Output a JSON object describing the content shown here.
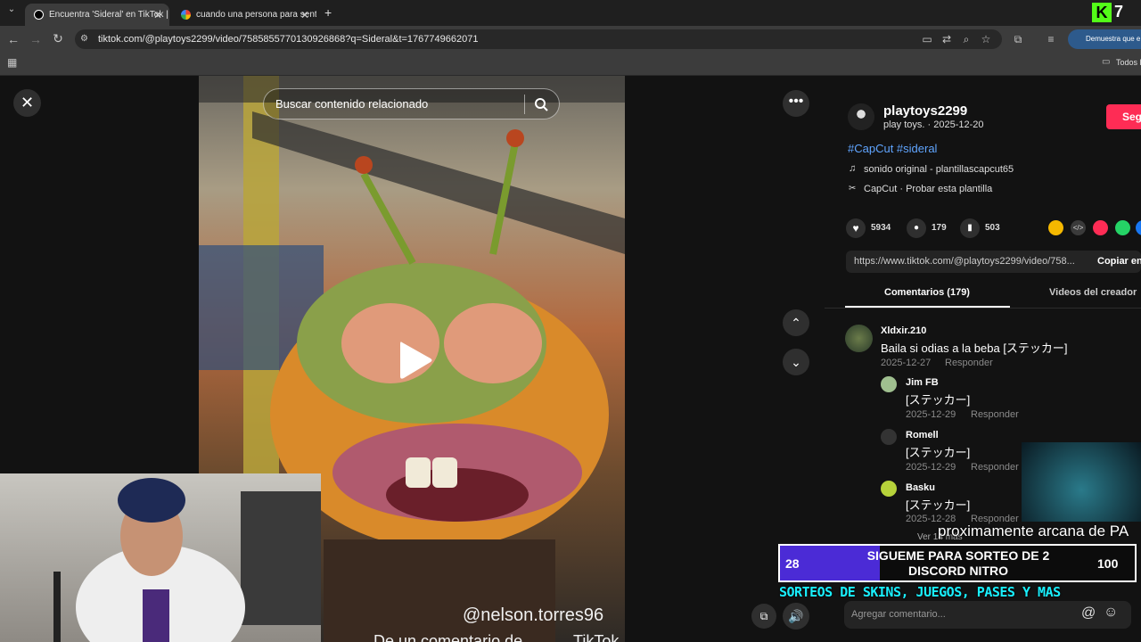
{
  "browser": {
    "tabs": [
      {
        "title": "Encuentra 'Sideral' en TikTok | B"
      },
      {
        "title": "cuando una persona para senta"
      }
    ],
    "new_tab": "+",
    "url": "tiktok.com/@playtoys2299/video/7585855770130926868?q=Sideral&t=1767749662071",
    "profile_text": "Demuestra que e",
    "bookmarks_all": "Todos l",
    "k_badge": "7"
  },
  "video": {
    "search_placeholder": "Buscar contenido relacionado",
    "watermark": "@nelson.torres96",
    "bottom_caption": "De un comentario de",
    "tiktok_mark": "TikTok"
  },
  "author": {
    "username": "playtoys2299",
    "subline": "play toys. · 2025-12-20",
    "follow": "Seg",
    "hashtags": "#CapCut #sideral",
    "sound": "sonido original - plantillascapcut65",
    "capcut": "CapCut · Probar esta plantilla"
  },
  "stats": {
    "likes": "5934",
    "comments": "179",
    "saves": "503"
  },
  "share": {
    "link": "https://www.tiktok.com/@playtoys2299/video/758...",
    "copy": "Copiar en"
  },
  "tabs": {
    "comments": "Comentarios (179)",
    "creator": "Videos del creador"
  },
  "comments": [
    {
      "name": "Xldxir.210",
      "text": "Baila si odias a la beba [ステッカー]",
      "date": "2025-12-27",
      "reply": "Responder"
    },
    {
      "name": "Jim FB",
      "text": "[ステッカー]",
      "date": "2025-12-29",
      "reply": "Responder"
    },
    {
      "name": "Romell",
      "text": "[ステッカー]",
      "date": "2025-12-29",
      "reply": "Responder"
    },
    {
      "name": "Basku",
      "text": "[ステッカー]",
      "date": "2025-12-28",
      "reply": "Responder"
    }
  ],
  "more_replies": "Ver 14 más",
  "add_comment_placeholder": "Agregar comentario...",
  "overlay": {
    "promo_caption": "proximamente arcana de PA",
    "goal_left": "28",
    "goal_text_line1": "SIGUEME PARA SORTEO DE 2",
    "goal_text_line2": "DISCORD NITRO",
    "goal_right": "100",
    "goal_fraction": 0.28,
    "banner": "SORTEOS DE SKINS, JUEGOS, PASES Y MAS"
  },
  "colors": {
    "follow": "#fe2c55",
    "goal_fill": "#4b2bd6",
    "banner": "#19f0ff"
  }
}
